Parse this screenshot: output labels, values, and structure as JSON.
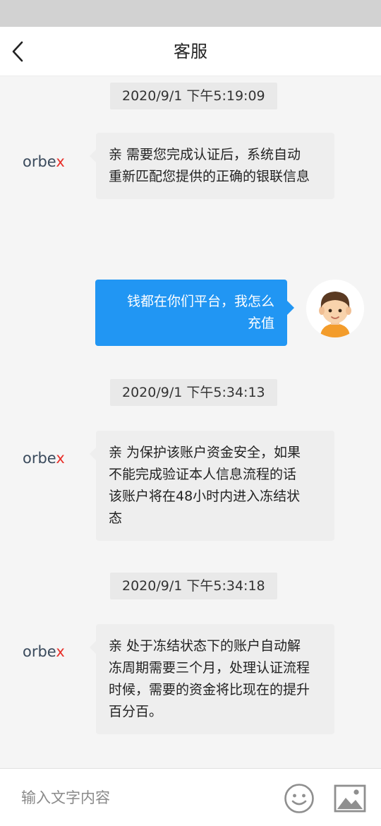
{
  "header": {
    "title": "客服",
    "back_icon": "chevron-left-icon"
  },
  "agent": {
    "logo_text": "orbex",
    "logo_color": "#3a4a5c",
    "logo_accent_color": "#e8302a"
  },
  "messages": [
    {
      "type": "timestamp",
      "text": "2020/9/1 下午5:19:09"
    },
    {
      "type": "agent",
      "lines": [
        "亲 需要您完成认证后，系统自动",
        "重新匹配您提供的正确的银联信息"
      ]
    },
    {
      "type": "user",
      "lines": [
        "钱都在你们平台，我怎么",
        "充值"
      ]
    },
    {
      "type": "timestamp",
      "text": "2020/9/1 下午5:34:13"
    },
    {
      "type": "agent",
      "lines": [
        "亲 为保护该账户资金安全，如果",
        "不能完成验证本人信息流程的话",
        "该账户将在48小时内进入冻结状",
        "态"
      ]
    },
    {
      "type": "timestamp",
      "text": "2020/9/1 下午5:34:18"
    },
    {
      "type": "agent",
      "lines": [
        "亲 处于冻结状态下的账户自动解",
        "冻周期需要三个月，处理认证流程",
        "时候，需要的资金将比现在的提升",
        "百分百。"
      ]
    }
  ],
  "input_bar": {
    "placeholder": "输入文字内容",
    "emoji_icon": "smiley-icon",
    "image_icon": "image-icon"
  },
  "colors": {
    "user_bubble": "#2196f3",
    "agent_bubble": "#eeeeee",
    "timestamp_bg": "#e9e9e9"
  }
}
